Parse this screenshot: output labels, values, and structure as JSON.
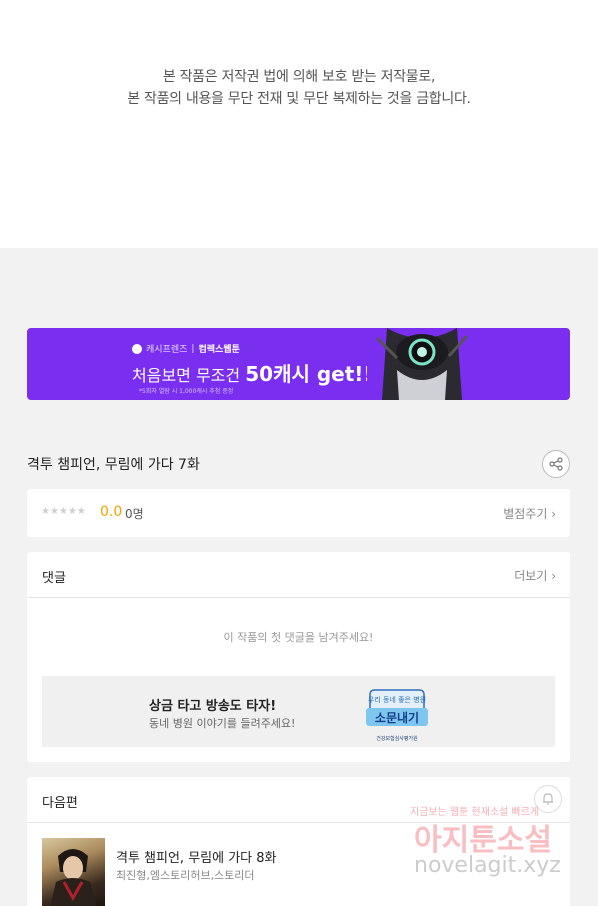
{
  "copyright": {
    "line1": "본 작품은 저작권 법에 의해 보호 받는 저작물로,",
    "line2": "본 작품의 내용을 무단 전재 및 무단 복제하는 것을 금합니다."
  },
  "banner": {
    "brand": "캐시프렌즈",
    "partner": "컴렉스웹툰",
    "promo_prefix": "처음보면 무조건",
    "promo_big": "50캐시 get!!",
    "fine_print": "*5회차 열람 시 1,000캐시 추첨 증정",
    "accent_color": "#7a2ef0"
  },
  "episode": {
    "title": "격투 챔피언, 무림에 가다 7화",
    "share_icon": "share-icon"
  },
  "rating": {
    "stars": "★★★★★",
    "score": "0.0",
    "count": "0명",
    "rate_link": "별점주기 ›"
  },
  "comments": {
    "label": "댓글",
    "more": "더보기 ›",
    "empty_message": "이 작품의 첫 댓글을 남겨주세요!",
    "event_title": "상금 타고 방송도 타자!",
    "event_sub": "동네 병원 이야기를 들려주세요!",
    "event_logo_text": "소문내기",
    "event_logo_top": "우리 동네 좋은 병원",
    "event_logo_bottom": "건강보험심사평가원"
  },
  "next": {
    "label": "다음편",
    "title": "격투 챔피언, 무림에 가다 8화",
    "meta": "최진형,엠스토리허브,스토리더"
  },
  "watermark": {
    "line1": "지금보는 웹툰 현재소설 빠르게",
    "line2": "아지툰소설",
    "line3": "novelagit.xyz"
  }
}
